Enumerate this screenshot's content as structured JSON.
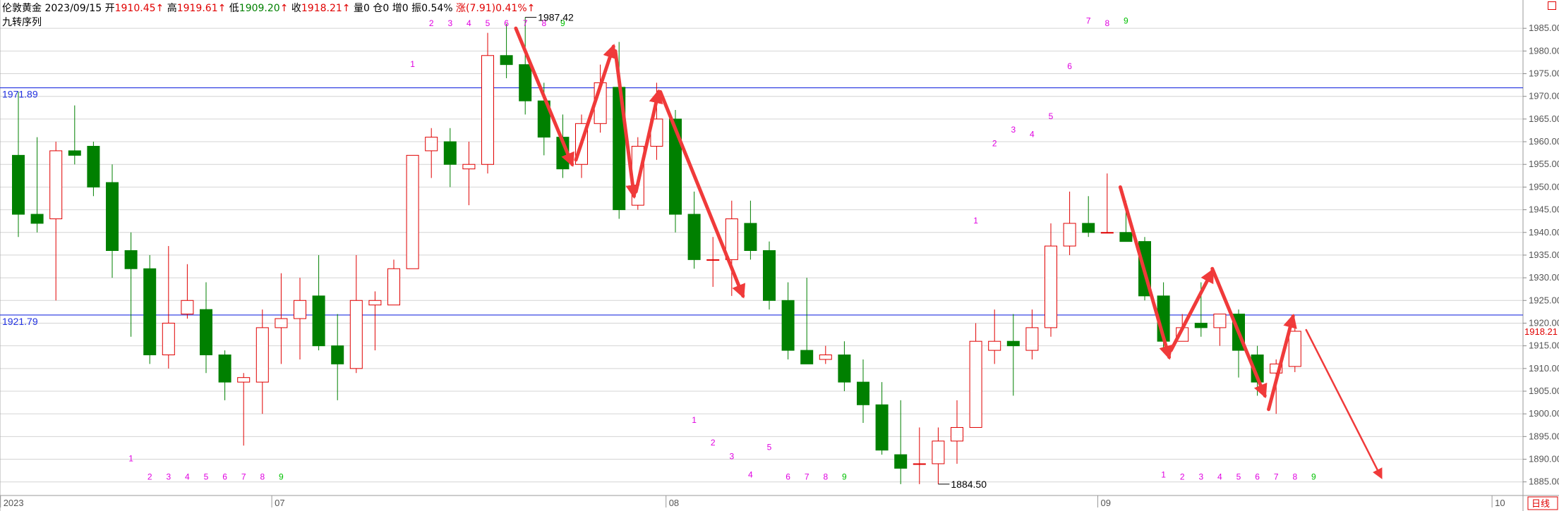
{
  "header": {
    "instrument": "伦敦黄金",
    "date": "2023/09/15",
    "open_label": "开",
    "open": "1910.45",
    "high_label": "高",
    "high": "1919.61",
    "low_label": "低",
    "low": "1909.20",
    "close_label": "收",
    "close": "1918.21",
    "volume_label": "量",
    "volume": "0",
    "oi_label": "仓",
    "oi": "0",
    "inc_label": "增",
    "inc": "0",
    "amp_label": "振",
    "amp": "0.54%",
    "chg_label": "涨",
    "chg": "(7.91)",
    "chg_pct": "0.41%",
    "arrow": "↑",
    "indicator": "九转序列"
  },
  "colors": {
    "up": "#e00000",
    "down": "#008000",
    "hline": "#2030e0",
    "grid": "#d4d4d4",
    "arrow": "#f03a3a",
    "seq": "#e000e0",
    "seq9": "#00c000"
  },
  "chart_data": {
    "type": "candlestick",
    "period_label": "日线",
    "y_range": [
      1882,
      1990
    ],
    "y_ticks": [
      "1885.00",
      "1890.00",
      "1895.00",
      "1900.00",
      "1905.00",
      "1910.00",
      "1915.00",
      "1920.00",
      "1925.00",
      "1930.00",
      "1935.00",
      "1940.00",
      "1945.00",
      "1950.00",
      "1955.00",
      "1960.00",
      "1965.00",
      "1970.00",
      "1975.00",
      "1980.00",
      "1985.00"
    ],
    "x_labels": [
      {
        "text": "2023",
        "index": 0
      },
      {
        "text": "07",
        "index": 14
      },
      {
        "text": "08",
        "index": 35
      },
      {
        "text": "09",
        "index": 58
      },
      {
        "text": "10",
        "index": 79
      }
    ],
    "hlines": [
      {
        "value": 1971.89,
        "label": "1971.89"
      },
      {
        "value": 1921.79,
        "label": "1921.79"
      }
    ],
    "last_price": {
      "value": 1918.21,
      "label": "1918.21"
    },
    "annotations": [
      {
        "text": "1987.42",
        "index": 27,
        "value": 1987.42
      },
      {
        "text": "1884.50",
        "index": 49,
        "value": 1884.5
      }
    ],
    "candles": [
      {
        "o": 1957,
        "h": 1971,
        "l": 1939,
        "c": 1944
      },
      {
        "o": 1944,
        "h": 1961,
        "l": 1940,
        "c": 1942
      },
      {
        "o": 1943,
        "h": 1960,
        "l": 1925,
        "c": 1958
      },
      {
        "o": 1958,
        "h": 1968,
        "l": 1955,
        "c": 1957
      },
      {
        "o": 1959,
        "h": 1960,
        "l": 1948,
        "c": 1950
      },
      {
        "o": 1951,
        "h": 1955,
        "l": 1930,
        "c": 1936
      },
      {
        "o": 1936,
        "h": 1940,
        "l": 1917,
        "c": 1932
      },
      {
        "o": 1932,
        "h": 1935,
        "l": 1911,
        "c": 1913
      },
      {
        "o": 1913,
        "h": 1937,
        "l": 1910,
        "c": 1920
      },
      {
        "o": 1922,
        "h": 1933,
        "l": 1921,
        "c": 1925
      },
      {
        "o": 1923,
        "h": 1929,
        "l": 1909,
        "c": 1913
      },
      {
        "o": 1913,
        "h": 1914,
        "l": 1903,
        "c": 1907
      },
      {
        "o": 1907,
        "h": 1909,
        "l": 1893,
        "c": 1908
      },
      {
        "o": 1907,
        "h": 1923,
        "l": 1900,
        "c": 1919
      },
      {
        "o": 1919,
        "h": 1931,
        "l": 1911,
        "c": 1921
      },
      {
        "o": 1921,
        "h": 1930,
        "l": 1912,
        "c": 1925
      },
      {
        "o": 1926,
        "h": 1935,
        "l": 1914,
        "c": 1915
      },
      {
        "o": 1915,
        "h": 1922,
        "l": 1903,
        "c": 1911
      },
      {
        "o": 1910,
        "h": 1935,
        "l": 1909,
        "c": 1925
      },
      {
        "o": 1924,
        "h": 1927,
        "l": 1914,
        "c": 1925
      },
      {
        "o": 1924,
        "h": 1934,
        "l": 1924,
        "c": 1932
      },
      {
        "o": 1932,
        "h": 1957,
        "l": 1932,
        "c": 1957
      },
      {
        "o": 1958,
        "h": 1963,
        "l": 1952,
        "c": 1961
      },
      {
        "o": 1960,
        "h": 1963,
        "l": 1950,
        "c": 1955
      },
      {
        "o": 1954,
        "h": 1960,
        "l": 1946,
        "c": 1955
      },
      {
        "o": 1955,
        "h": 1984,
        "l": 1953,
        "c": 1979
      },
      {
        "o": 1979,
        "h": 1986,
        "l": 1974,
        "c": 1977
      },
      {
        "o": 1977,
        "h": 1987.42,
        "l": 1966,
        "c": 1969
      },
      {
        "o": 1969,
        "h": 1973,
        "l": 1957,
        "c": 1961
      },
      {
        "o": 1961,
        "h": 1966,
        "l": 1952,
        "c": 1954
      },
      {
        "o": 1955,
        "h": 1966,
        "l": 1952,
        "c": 1964
      },
      {
        "o": 1964,
        "h": 1977,
        "l": 1962,
        "c": 1973
      },
      {
        "o": 1972,
        "h": 1982,
        "l": 1943,
        "c": 1945
      },
      {
        "o": 1946,
        "h": 1961,
        "l": 1945,
        "c": 1959
      },
      {
        "o": 1959,
        "h": 1973,
        "l": 1956,
        "c": 1965
      },
      {
        "o": 1965,
        "h": 1967,
        "l": 1940,
        "c": 1944
      },
      {
        "o": 1944,
        "h": 1949,
        "l": 1932,
        "c": 1934
      },
      {
        "o": 1934,
        "h": 1939,
        "l": 1928,
        "c": 1934
      },
      {
        "o": 1934,
        "h": 1947,
        "l": 1926,
        "c": 1943
      },
      {
        "o": 1942,
        "h": 1947,
        "l": 1934,
        "c": 1936
      },
      {
        "o": 1936,
        "h": 1938,
        "l": 1923,
        "c": 1925
      },
      {
        "o": 1925,
        "h": 1929,
        "l": 1912,
        "c": 1914
      },
      {
        "o": 1914,
        "h": 1930,
        "l": 1911,
        "c": 1911
      },
      {
        "o": 1912,
        "h": 1915,
        "l": 1911,
        "c": 1913
      },
      {
        "o": 1913,
        "h": 1916,
        "l": 1905,
        "c": 1907
      },
      {
        "o": 1907,
        "h": 1912,
        "l": 1898,
        "c": 1902
      },
      {
        "o": 1902,
        "h": 1907,
        "l": 1891,
        "c": 1892
      },
      {
        "o": 1891,
        "h": 1903,
        "l": 1884.5,
        "c": 1888
      },
      {
        "o": 1889,
        "h": 1897,
        "l": 1884.5,
        "c": 1889
      },
      {
        "o": 1889,
        "h": 1897,
        "l": 1884.5,
        "c": 1894
      },
      {
        "o": 1894,
        "h": 1903,
        "l": 1889,
        "c": 1897
      },
      {
        "o": 1897,
        "h": 1920,
        "l": 1897,
        "c": 1916
      },
      {
        "o": 1914,
        "h": 1923,
        "l": 1911,
        "c": 1916
      },
      {
        "o": 1916,
        "h": 1922,
        "l": 1904,
        "c": 1915
      },
      {
        "o": 1914,
        "h": 1923,
        "l": 1912,
        "c": 1919
      },
      {
        "o": 1919,
        "h": 1942,
        "l": 1917,
        "c": 1937
      },
      {
        "o": 1937,
        "h": 1949,
        "l": 1935,
        "c": 1942
      },
      {
        "o": 1942,
        "h": 1948,
        "l": 1939,
        "c": 1940
      },
      {
        "o": 1940,
        "h": 1953,
        "l": 1940,
        "c": 1940
      },
      {
        "o": 1940,
        "h": 1947,
        "l": 1939,
        "c": 1938
      },
      {
        "o": 1938,
        "h": 1939,
        "l": 1925,
        "c": 1926
      },
      {
        "o": 1926,
        "h": 1929,
        "l": 1914,
        "c": 1916
      },
      {
        "o": 1916,
        "h": 1922,
        "l": 1916,
        "c": 1919
      },
      {
        "o": 1920,
        "h": 1929,
        "l": 1917,
        "c": 1919
      },
      {
        "o": 1919,
        "h": 1922,
        "l": 1915,
        "c": 1922
      },
      {
        "o": 1922,
        "h": 1923,
        "l": 1908,
        "c": 1914
      },
      {
        "o": 1913,
        "h": 1915,
        "l": 1904,
        "c": 1907
      },
      {
        "o": 1909,
        "h": 1912,
        "l": 1900,
        "c": 1911
      },
      {
        "o": 1910.45,
        "h": 1919.61,
        "l": 1909.2,
        "c": 1918.21
      }
    ],
    "sequence_marks": [
      {
        "text": "1",
        "index": 6,
        "value": 1889.5,
        "kind": "low"
      },
      {
        "text": "2",
        "index": 7,
        "value": 1885.5,
        "kind": "low"
      },
      {
        "text": "3",
        "index": 8,
        "value": 1885.5,
        "kind": "low"
      },
      {
        "text": "4",
        "index": 9,
        "value": 1885.5,
        "kind": "low"
      },
      {
        "text": "5",
        "index": 10,
        "value": 1885.5,
        "kind": "low"
      },
      {
        "text": "6",
        "index": 11,
        "value": 1885.5,
        "kind": "low"
      },
      {
        "text": "7",
        "index": 12,
        "value": 1885.5,
        "kind": "low"
      },
      {
        "text": "8",
        "index": 13,
        "value": 1885.5,
        "kind": "low"
      },
      {
        "text": "9",
        "index": 14,
        "value": 1885.5,
        "kind": "low9"
      },
      {
        "text": "1",
        "index": 21,
        "value": 1976.5,
        "kind": "high"
      },
      {
        "text": "2",
        "index": 22,
        "value": 1985.5,
        "kind": "high"
      },
      {
        "text": "3",
        "index": 23,
        "value": 1985.5,
        "kind": "high"
      },
      {
        "text": "4",
        "index": 24,
        "value": 1985.5,
        "kind": "high"
      },
      {
        "text": "5",
        "index": 25,
        "value": 1985.5,
        "kind": "high"
      },
      {
        "text": "6",
        "index": 26,
        "value": 1985.5,
        "kind": "high"
      },
      {
        "text": "7",
        "index": 27,
        "value": 1985.5,
        "kind": "high"
      },
      {
        "text": "8",
        "index": 28,
        "value": 1985.5,
        "kind": "high"
      },
      {
        "text": "9",
        "index": 29,
        "value": 1985.5,
        "kind": "high9"
      },
      {
        "text": "1",
        "index": 36,
        "value": 1898,
        "kind": "low"
      },
      {
        "text": "2",
        "index": 37,
        "value": 1893,
        "kind": "low"
      },
      {
        "text": "3",
        "index": 38,
        "value": 1890,
        "kind": "low"
      },
      {
        "text": "4",
        "index": 39,
        "value": 1886,
        "kind": "low"
      },
      {
        "text": "5",
        "index": 40,
        "value": 1892,
        "kind": "low"
      },
      {
        "text": "6",
        "index": 41,
        "value": 1885.5,
        "kind": "low"
      },
      {
        "text": "7",
        "index": 42,
        "value": 1885.5,
        "kind": "low"
      },
      {
        "text": "8",
        "index": 43,
        "value": 1885.5,
        "kind": "low"
      },
      {
        "text": "9",
        "index": 44,
        "value": 1885.5,
        "kind": "low9"
      },
      {
        "text": "1",
        "index": 51,
        "value": 1942,
        "kind": "high"
      },
      {
        "text": "2",
        "index": 52,
        "value": 1959,
        "kind": "high"
      },
      {
        "text": "3",
        "index": 53,
        "value": 1962,
        "kind": "high"
      },
      {
        "text": "4",
        "index": 54,
        "value": 1961,
        "kind": "high"
      },
      {
        "text": "5",
        "index": 55,
        "value": 1965,
        "kind": "high"
      },
      {
        "text": "6",
        "index": 56,
        "value": 1976,
        "kind": "high"
      },
      {
        "text": "7",
        "index": 57,
        "value": 1986,
        "kind": "high"
      },
      {
        "text": "8",
        "index": 58,
        "value": 1985.5,
        "kind": "high"
      },
      {
        "text": "9",
        "index": 59,
        "value": 1986,
        "kind": "high9"
      },
      {
        "text": "1",
        "index": 61,
        "value": 1886,
        "kind": "low"
      },
      {
        "text": "2",
        "index": 62,
        "value": 1885.5,
        "kind": "low"
      },
      {
        "text": "3",
        "index": 63,
        "value": 1885.5,
        "kind": "low"
      },
      {
        "text": "4",
        "index": 64,
        "value": 1885.5,
        "kind": "low"
      },
      {
        "text": "5",
        "index": 65,
        "value": 1885.5,
        "kind": "low"
      },
      {
        "text": "6",
        "index": 66,
        "value": 1885.5,
        "kind": "low"
      },
      {
        "text": "7",
        "index": 67,
        "value": 1885.5,
        "kind": "low"
      },
      {
        "text": "8",
        "index": 68,
        "value": 1885.5,
        "kind": "low"
      },
      {
        "text": "9",
        "index": 69,
        "value": 1885.5,
        "kind": "low9"
      }
    ],
    "trend_arrows": [
      {
        "from": [
          26.5,
          1985
        ],
        "to": [
          29.5,
          1955
        ],
        "width": "thick"
      },
      {
        "from": [
          29.7,
          1956
        ],
        "to": [
          31.7,
          1981
        ],
        "width": "thick"
      },
      {
        "from": [
          31.8,
          1980
        ],
        "to": [
          32.8,
          1948
        ],
        "width": "thick"
      },
      {
        "from": [
          32.9,
          1949
        ],
        "to": [
          34.1,
          1971
        ],
        "width": "thick"
      },
      {
        "from": [
          34.2,
          1971
        ],
        "to": [
          38.6,
          1926
        ],
        "width": "thick"
      },
      {
        "from": [
          58.7,
          1950
        ],
        "to": [
          61.3,
          1912.5
        ],
        "width": "thick"
      },
      {
        "from": [
          61.4,
          1914
        ],
        "to": [
          63.6,
          1931.5
        ],
        "width": "thick"
      },
      {
        "from": [
          63.6,
          1932
        ],
        "to": [
          66.4,
          1904
        ],
        "width": "thick"
      },
      {
        "from": [
          66.6,
          1901
        ],
        "to": [
          67.9,
          1921.5
        ],
        "width": "thick"
      },
      {
        "from": [
          68.6,
          1918.5
        ],
        "to": [
          72.6,
          1886
        ],
        "width": "thin"
      }
    ]
  }
}
